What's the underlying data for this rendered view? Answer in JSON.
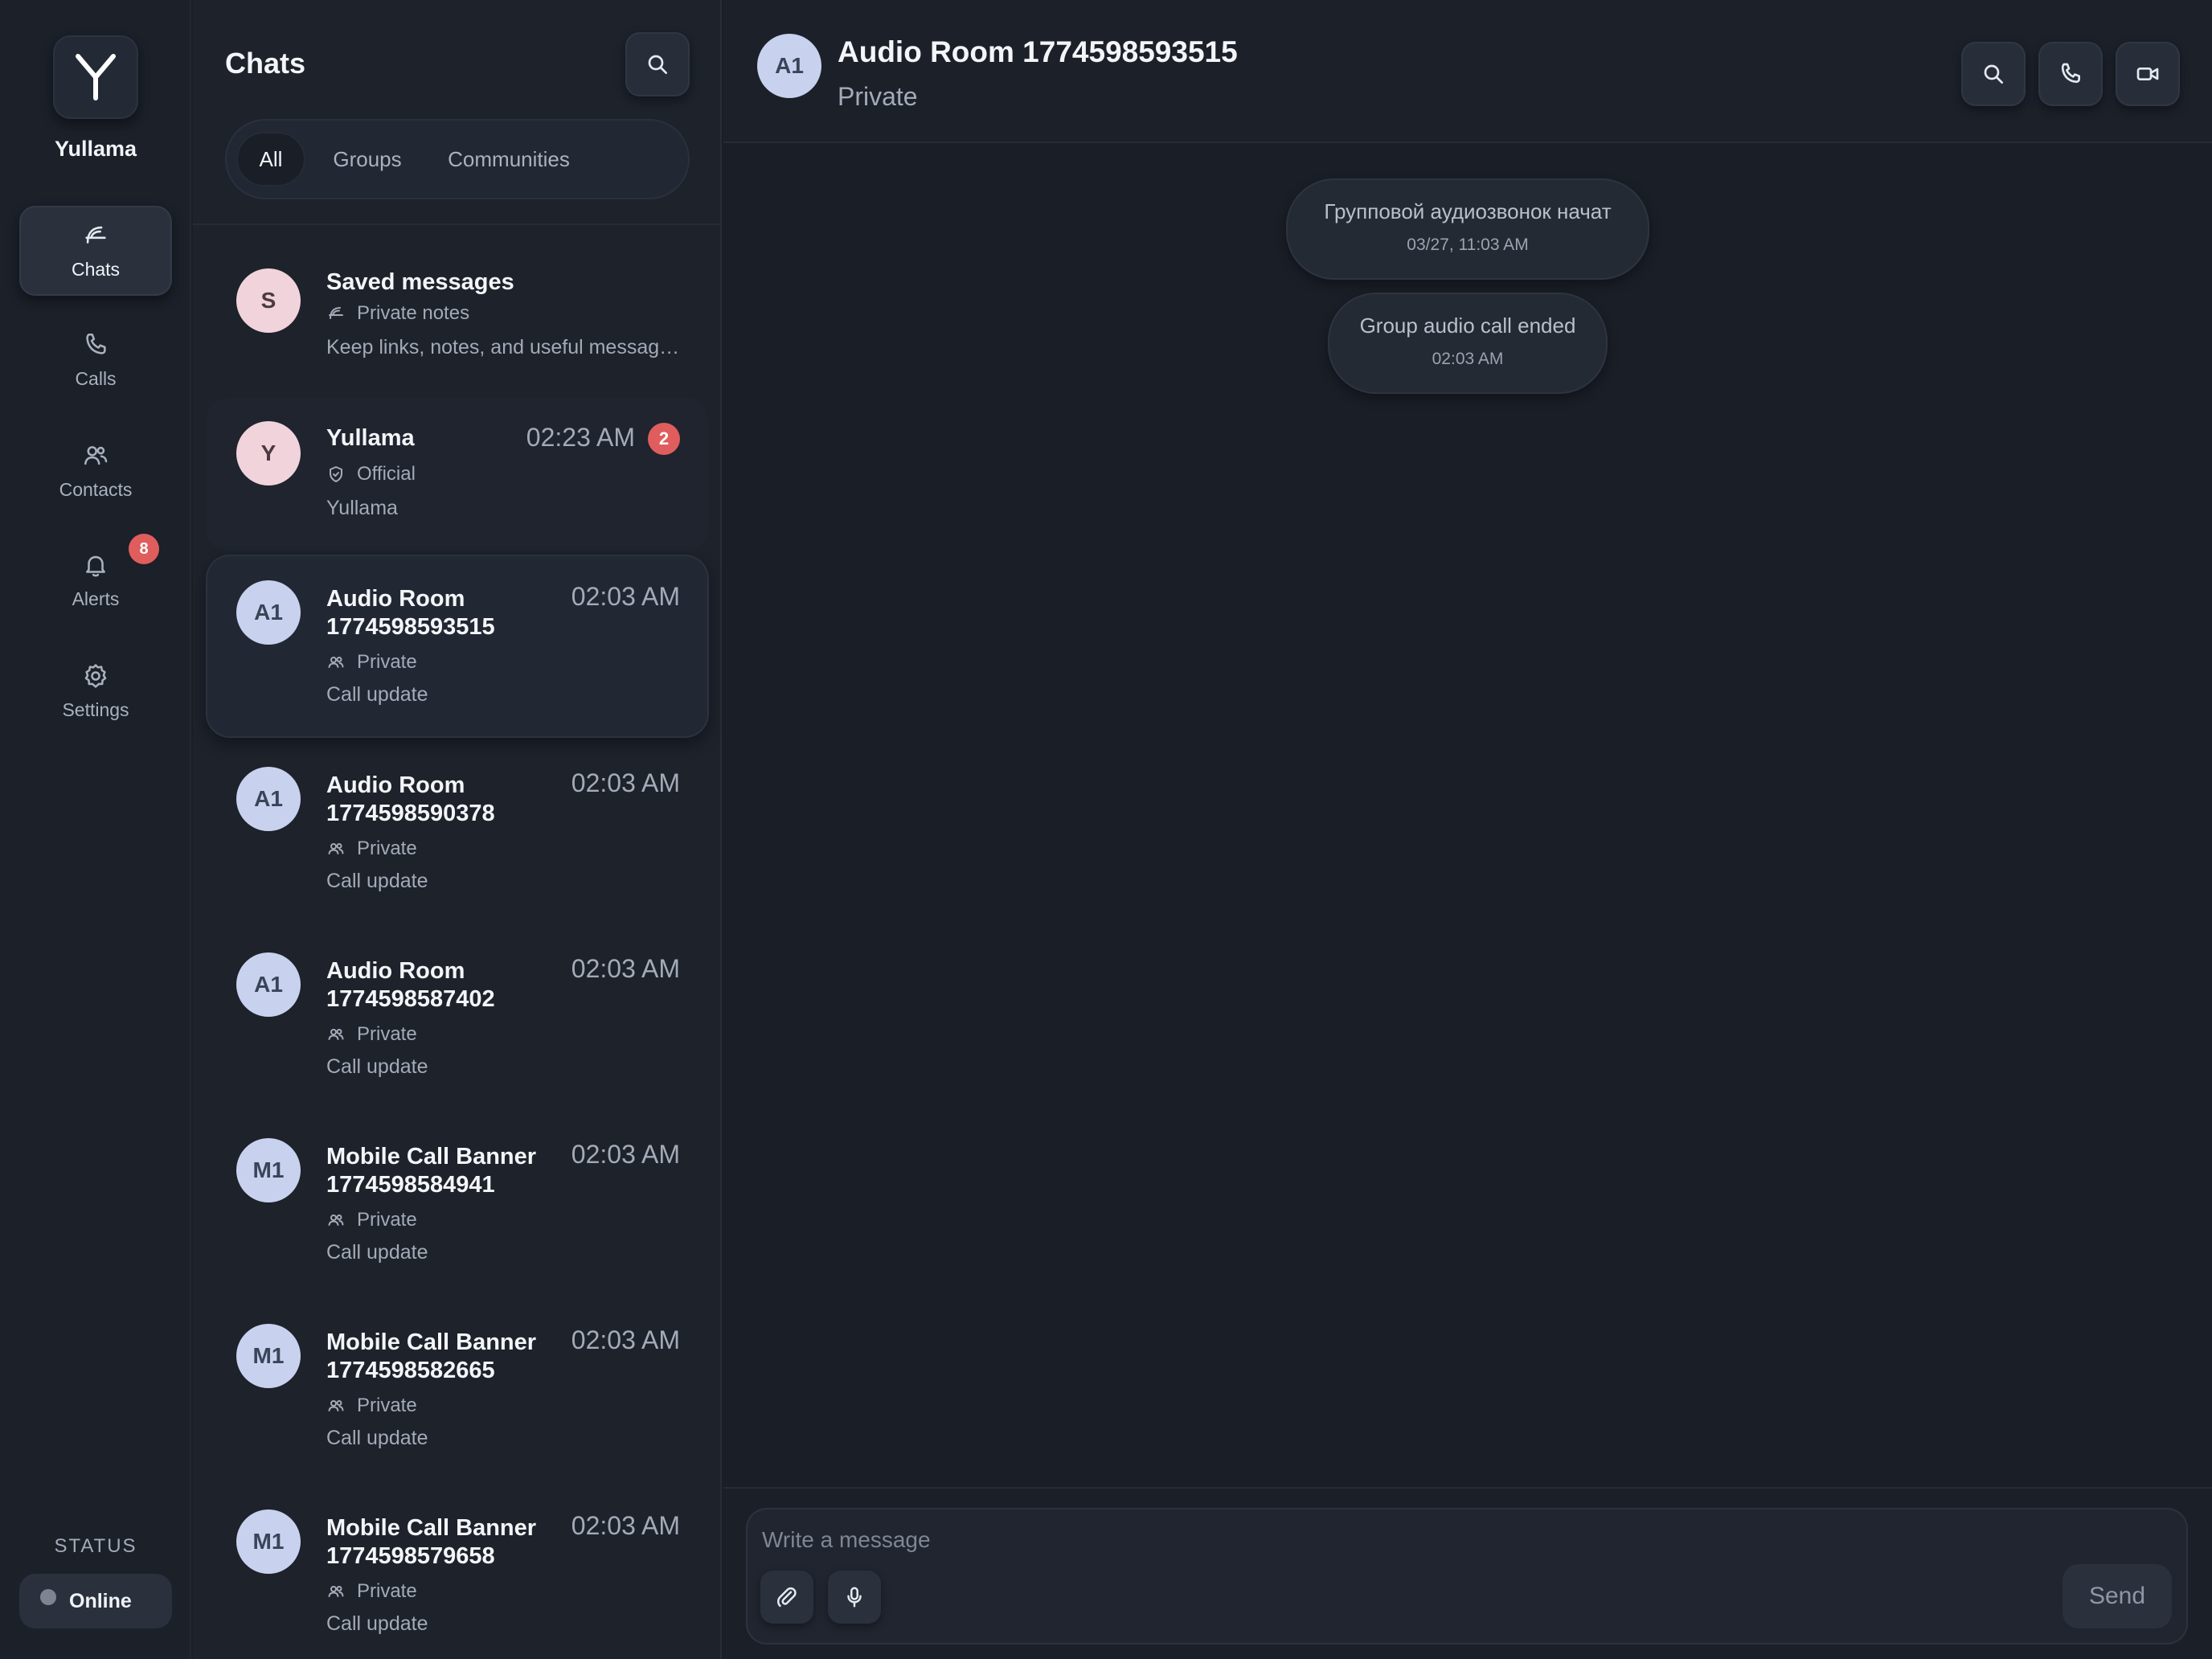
{
  "app": {
    "name": "Yullama",
    "colors": {
      "background": "#1a1e26",
      "accent_badge": "#e05d5d",
      "avatar_blue": "#c8d2ef",
      "avatar_pink": "#f1d3dc"
    }
  },
  "rail": {
    "brand": "Yullama",
    "items": [
      {
        "label": "Chats",
        "icon": "chat-icon",
        "active": true
      },
      {
        "label": "Calls",
        "icon": "phone-icon"
      },
      {
        "label": "Contacts",
        "icon": "contacts-icon"
      },
      {
        "label": "Alerts",
        "icon": "bell-icon",
        "badge": "8"
      },
      {
        "label": "Settings",
        "icon": "gear-icon"
      }
    ],
    "status_label": "STATUS",
    "status_value": "Online"
  },
  "list": {
    "title": "Chats",
    "tabs": [
      {
        "label": "All",
        "active": true
      },
      {
        "label": "Groups"
      },
      {
        "label": "Communities"
      }
    ],
    "chats": [
      {
        "initials": "S",
        "name": "Saved messages",
        "meta": "Private notes",
        "meta_icon": "chat-icon",
        "preview": "Keep links, notes, and useful messages",
        "time": ""
      },
      {
        "initials": "Y",
        "name": "Yullama",
        "meta": "Official",
        "meta_icon": "shield-icon",
        "preview": "Yullama",
        "time": "02:23 AM",
        "badge": "2"
      },
      {
        "initials": "A1",
        "name": "Audio Room 1774598593515",
        "meta": "Private",
        "meta_icon": "users-icon",
        "preview": "Call update",
        "time": "02:03 AM",
        "selected": true
      },
      {
        "initials": "A1",
        "name": "Audio Room 1774598590378",
        "meta": "Private",
        "meta_icon": "users-icon",
        "preview": "Call update",
        "time": "02:03 AM"
      },
      {
        "initials": "A1",
        "name": "Audio Room 1774598587402",
        "meta": "Private",
        "meta_icon": "users-icon",
        "preview": "Call update",
        "time": "02:03 AM"
      },
      {
        "initials": "M1",
        "name": "Mobile Call Banner 1774598584941",
        "meta": "Private",
        "meta_icon": "users-icon",
        "preview": "Call update",
        "time": "02:03 AM"
      },
      {
        "initials": "M1",
        "name": "Mobile Call Banner 1774598582665",
        "meta": "Private",
        "meta_icon": "users-icon",
        "preview": "Call update",
        "time": "02:03 AM"
      },
      {
        "initials": "M1",
        "name": "Mobile Call Banner 1774598579658",
        "meta": "Private",
        "meta_icon": "users-icon",
        "preview": "Call update",
        "time": "02:03 AM"
      }
    ]
  },
  "conversation": {
    "initials": "A1",
    "title": "Audio Room 1774598593515",
    "subtitle": "Private",
    "messages": [
      {
        "text": "Групповой аудиозвонок начат",
        "time": "03/27, 11:03 AM"
      },
      {
        "text": "Group audio call ended",
        "time": "02:03 AM"
      }
    ],
    "composer": {
      "placeholder": "Write a message",
      "send_label": "Send"
    }
  }
}
